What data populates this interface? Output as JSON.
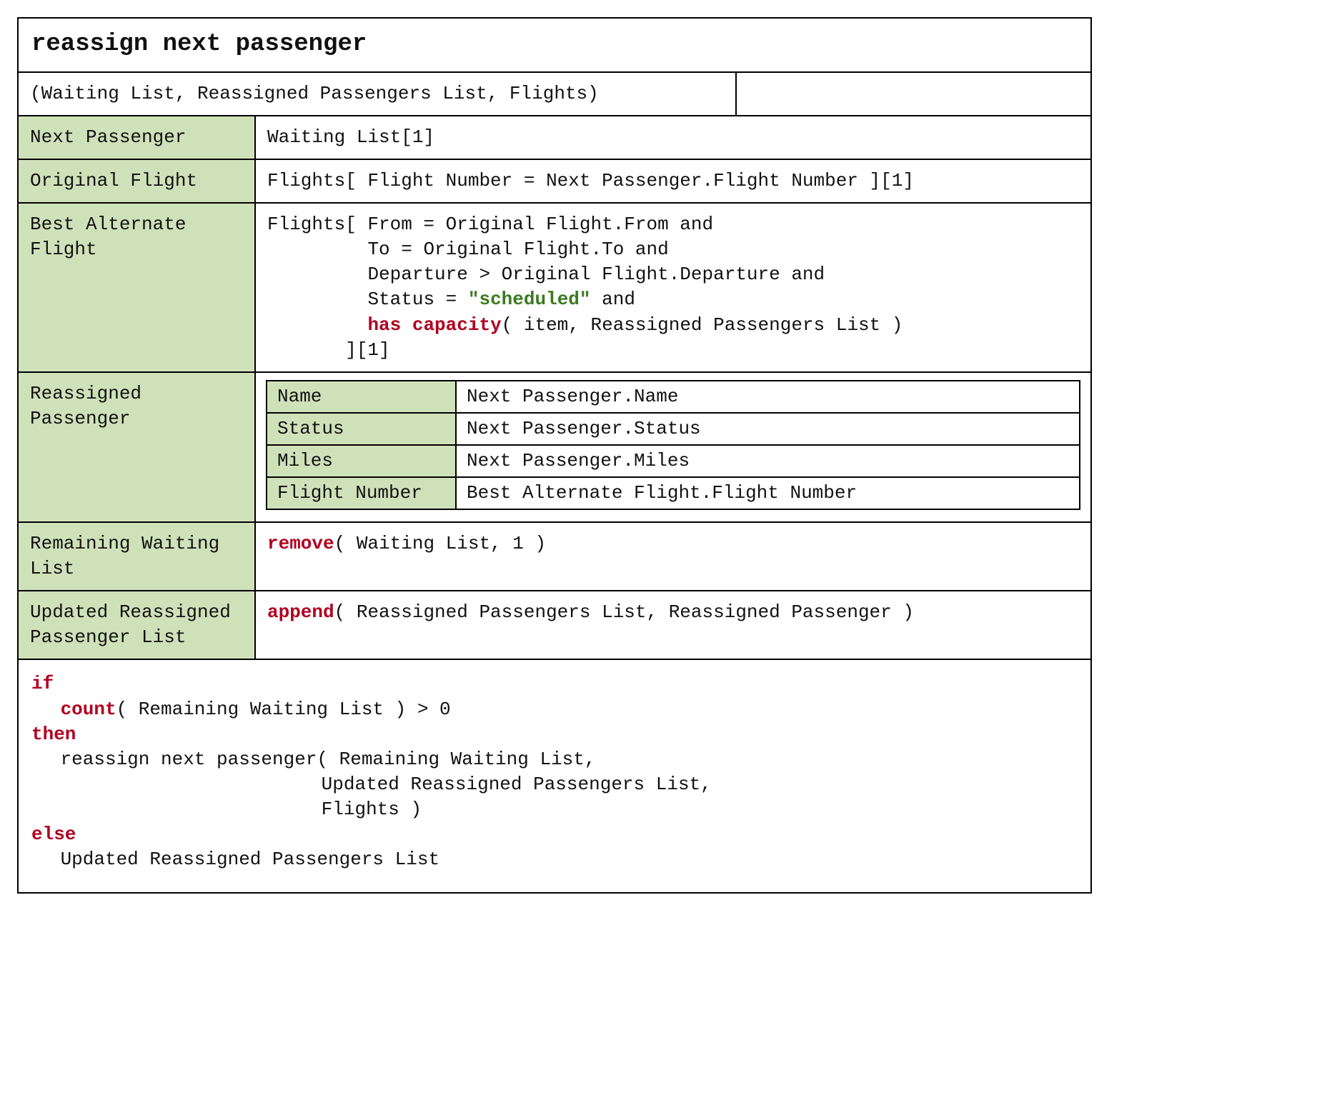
{
  "title": "reassign next passenger",
  "parameters": "(Waiting List, Reassigned Passengers List, Flights)",
  "rows": {
    "next_passenger": {
      "label": "Next Passenger",
      "value": "Waiting List[1]"
    },
    "original_flight": {
      "label": "Original Flight",
      "value": "Flights[ Flight Number = Next Passenger.Flight Number ][1]"
    },
    "best_alt": {
      "label": "Best Alternate Flight",
      "line1": "Flights[ From = Original Flight.From and",
      "line2": "         To = Original Flight.To and",
      "line3": "         Departure > Original Flight.Departure and",
      "line4a": "         Status = ",
      "line4b": "\"scheduled\"",
      "line4c": " and",
      "line5a": "         ",
      "line5b": "has capacity",
      "line5c": "( item, Reassigned Passengers List )",
      "line6": "       ][1]"
    },
    "reassigned_passenger": {
      "label": "Reassigned Passenger",
      "sub": [
        {
          "k": "Name",
          "v": "Next Passenger.Name"
        },
        {
          "k": "Status",
          "v": "Next Passenger.Status"
        },
        {
          "k": "Miles",
          "v": "Next Passenger.Miles"
        },
        {
          "k": "Flight Number",
          "v": "Best Alternate Flight.Flight Number"
        }
      ]
    },
    "remaining_waiting": {
      "label": "Remaining Waiting List",
      "kw": "remove",
      "rest": "( Waiting List, 1 )"
    },
    "updated_reassigned": {
      "label": "Updated Reassigned Passenger List",
      "kw": "append",
      "rest": "( Reassigned Passengers List, Reassigned Passenger )"
    }
  },
  "logic": {
    "if": "if",
    "count": "count",
    "cond_rest": "( Remaining Waiting List ) > 0",
    "then": "then",
    "call1": "reassign next passenger( Remaining Waiting List,",
    "call2": "Updated Reassigned Passengers List,",
    "call3": "Flights )",
    "else": "else",
    "else_body": "Updated Reassigned Passengers List"
  }
}
